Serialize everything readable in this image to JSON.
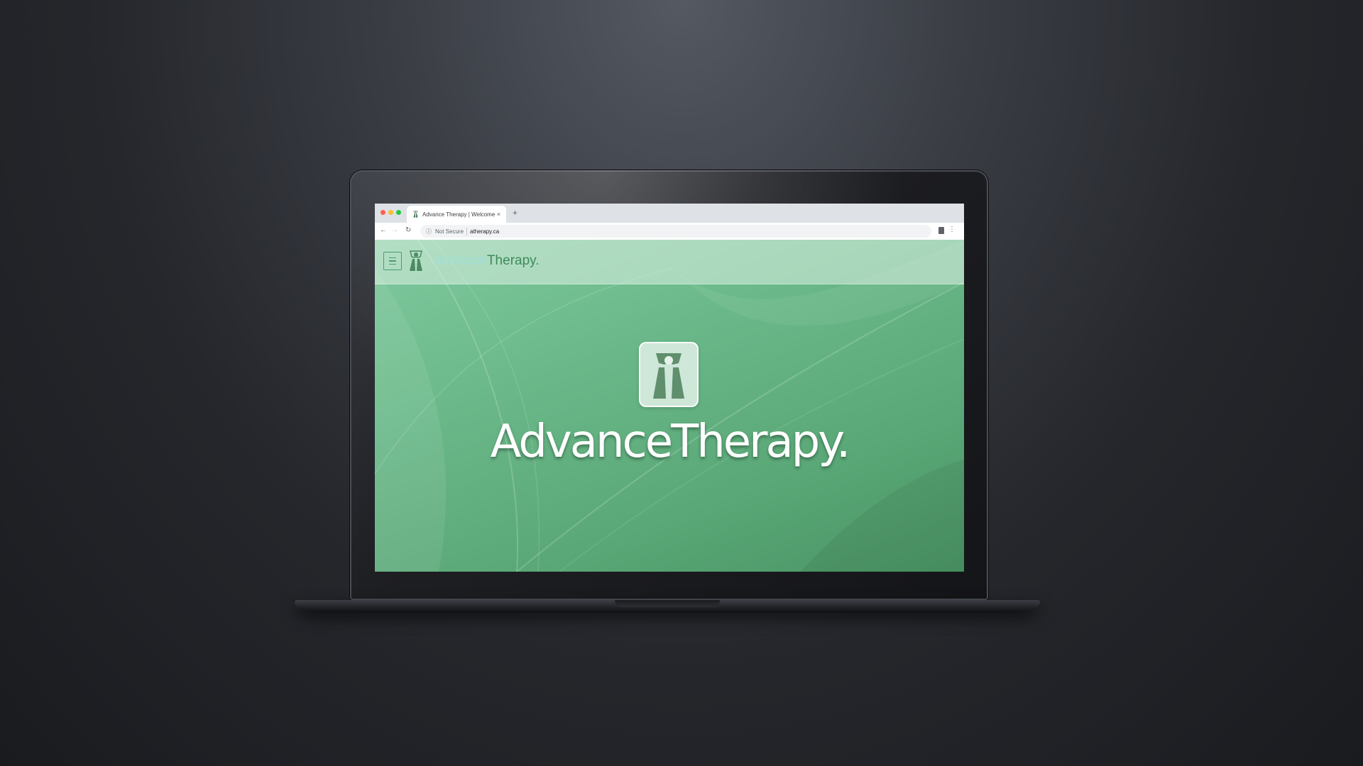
{
  "browser": {
    "tab_title": "Advance Therapy | Welcome",
    "tab_close": "×",
    "new_tab": "+",
    "security_label": "Not Secure",
    "url": "atherapy.ca",
    "info_glyph": "ⓘ",
    "menu_glyph": "⋮",
    "back_glyph": "←",
    "forward_glyph": "→",
    "reload_glyph": "↻"
  },
  "site": {
    "brand_part1": "Advance",
    "brand_part2": "Therapy.",
    "hero_title": "AdvanceTherapy."
  },
  "colors": {
    "accent_green": "#3f8a58",
    "brand_light": "#9fdfd9",
    "traffic_red": "#ff5f57",
    "traffic_yellow": "#febc2e",
    "traffic_green": "#28c840"
  },
  "icons": [
    "hamburger-menu-icon",
    "therapy-logo-icon",
    "info-icon",
    "extension-icon",
    "kebab-menu-icon"
  ]
}
